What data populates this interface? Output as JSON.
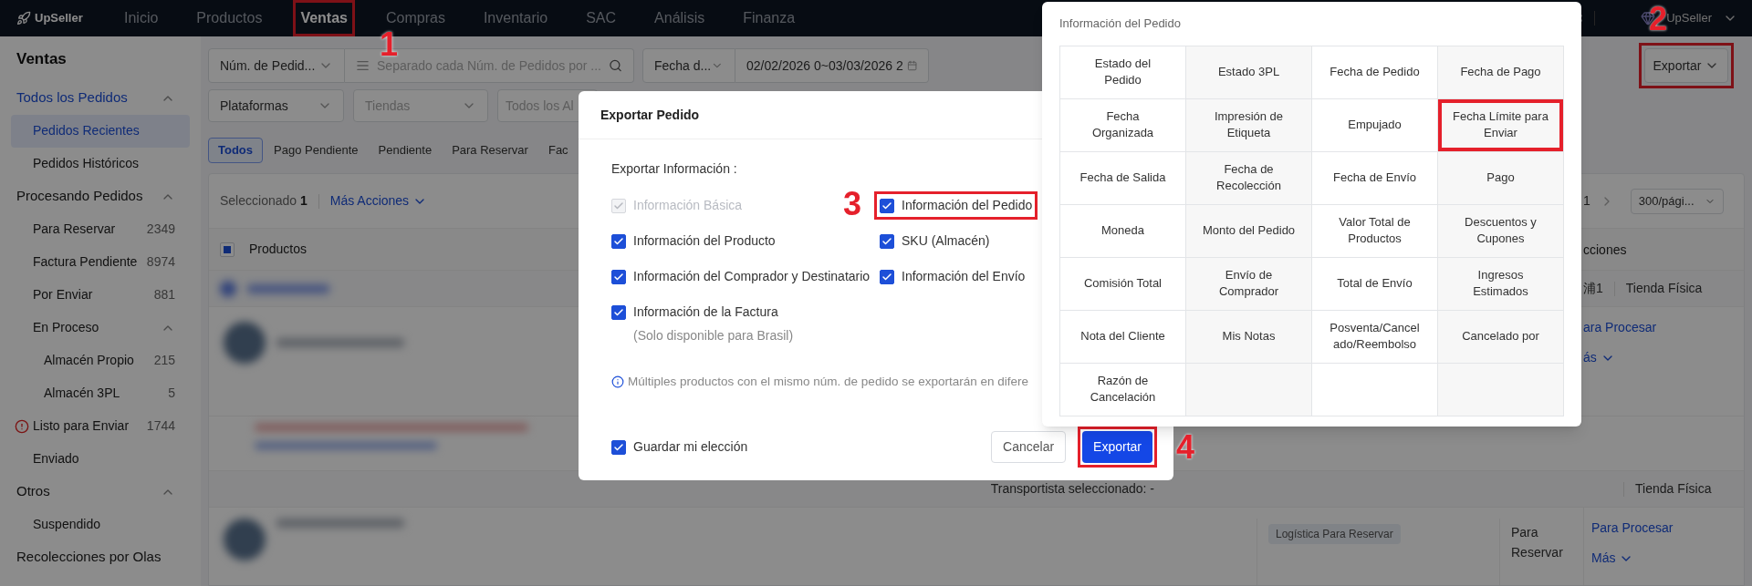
{
  "topbar": {
    "logo": "UpSeller",
    "nav": [
      {
        "label": "Inicio",
        "selected": false,
        "highlighted": false
      },
      {
        "label": "Productos",
        "selected": false,
        "highlighted": false
      },
      {
        "label": "Ventas",
        "selected": true,
        "highlighted": true
      },
      {
        "label": "Compras",
        "selected": false,
        "highlighted": false
      },
      {
        "label": "Inventario",
        "selected": false,
        "highlighted": false
      },
      {
        "label": "SAC",
        "selected": false,
        "highlighted": false
      },
      {
        "label": "Análisis",
        "selected": false,
        "highlighted": false
      },
      {
        "label": "Finanza",
        "selected": false,
        "highlighted": false
      }
    ],
    "user": "UpSeller"
  },
  "sidebar": {
    "title": "Ventas",
    "items": [
      {
        "label": "Todos los Pedidos",
        "active": true,
        "expanded": true,
        "children": [
          {
            "label": "Pedidos Recientes",
            "selected": true
          },
          {
            "label": "Pedidos Históricos",
            "selected": false
          }
        ]
      },
      {
        "label": "Procesando Pedidos",
        "active": false,
        "expanded": true,
        "children": [
          {
            "label": "Para Reservar",
            "count": "2349",
            "selected": false
          },
          {
            "label": "Factura Pendiente",
            "count": "8974",
            "selected": false
          },
          {
            "label": "Por Enviar",
            "count": "881",
            "selected": false
          },
          {
            "label": "En Proceso",
            "expanded": true,
            "selected": false,
            "children": [
              {
                "label": "Almacén Propio",
                "count": "215",
                "selected": false
              },
              {
                "label": "Almacén 3PL",
                "count": "5",
                "selected": false
              }
            ]
          },
          {
            "label": "Listo para Enviar",
            "count": "1744",
            "alert": true,
            "selected": false
          },
          {
            "label": "Enviado",
            "selected": false
          }
        ]
      },
      {
        "label": "Otros",
        "active": false,
        "expanded": true,
        "children": [
          {
            "label": "Suspendido",
            "selected": false
          }
        ]
      },
      {
        "label": "Recolecciones por Olas",
        "active": false
      }
    ]
  },
  "filters": {
    "search_type": "Núm. de Pedid...",
    "search_placeholder": "Separado cada Núm. de Pedidos por ...",
    "date_type": "Fecha d...",
    "date_range": "02/02/2026 0~03/03/2026 2",
    "platform": "Plataformas",
    "store_placeholder": "Tiendas",
    "warehouse_placeholder": "Todos los Al"
  },
  "export_button": {
    "label": "Exportar",
    "highlighted": true
  },
  "tabs": [
    {
      "label": "Todos",
      "selected": true
    },
    {
      "label": "Pago Pendiente",
      "selected": false
    },
    {
      "label": "Pendiente",
      "selected": false
    },
    {
      "label": "Para Reservar",
      "selected": false
    },
    {
      "label": "Fac",
      "selected": false
    }
  ],
  "toolbar": {
    "selected_label": "Seleccionado",
    "selected_count": "1",
    "more_actions": "Más Acciones",
    "page": "1",
    "page_size": "300/pági..."
  },
  "table": {
    "header_checkbox": {
      "indeterminate": true
    },
    "columns": [
      "Productos",
      "cciones"
    ],
    "group_1": {
      "shop": "浦1",
      "store_type": "Tienda Física"
    },
    "row_1": {
      "action": "ara Procesar",
      "more": "ás"
    },
    "group_2": {
      "carrier": "Transportista seleccionado: -",
      "store_type": "Tienda Física"
    },
    "row_2": {
      "tag": "Logística Para Reservar",
      "status": "Para Reservar",
      "action": "Para Procesar",
      "more": "Más"
    }
  },
  "modal": {
    "title": "Exportar Pedido",
    "section_label": "Exportar Información :",
    "options": [
      {
        "label": "Información Básica",
        "checked": true,
        "disabled": true,
        "highlighted": false
      },
      {
        "label": "Información del Pedido",
        "checked": true,
        "disabled": false,
        "highlighted": true
      },
      {
        "label": "Información del Producto",
        "checked": true,
        "disabled": false,
        "highlighted": false
      },
      {
        "label": "SKU (Almacén)",
        "checked": true,
        "disabled": false,
        "highlighted": false
      },
      {
        "label": "Información del Comprador y Destinatario",
        "checked": true,
        "disabled": false,
        "highlighted": false
      },
      {
        "label": "Información del Envío",
        "checked": true,
        "disabled": false,
        "highlighted": false
      },
      {
        "label": "Información de la Factura",
        "note": "(Solo disponible para Brasil)",
        "checked": true,
        "disabled": false,
        "highlighted": false
      }
    ],
    "notice": "Múltiples productos con el mismo núm. de pedido se exportarán en difere",
    "remember": {
      "label": "Guardar mi elección",
      "checked": true
    },
    "buttons": [
      {
        "label": "Cancelar",
        "kind": "secondary",
        "highlighted": false
      },
      {
        "label": "Exportar",
        "kind": "primary",
        "highlighted": true
      }
    ]
  },
  "popover": {
    "title": "Información del Pedido",
    "fields": [
      {
        "label": "Estado del Pedido",
        "highlighted": false
      },
      {
        "label": "Estado 3PL",
        "highlighted": false
      },
      {
        "label": "Fecha de Pedido",
        "highlighted": false
      },
      {
        "label": "Fecha de Pago",
        "highlighted": false
      },
      {
        "label": "Fecha Organizada",
        "highlighted": false
      },
      {
        "label": "Impresión de Etiqueta",
        "highlighted": false
      },
      {
        "label": "Empujado",
        "highlighted": false
      },
      {
        "label": "Fecha Límite para Enviar",
        "highlighted": true
      },
      {
        "label": "Fecha de Salida",
        "highlighted": false
      },
      {
        "label": "Fecha de Recolección",
        "highlighted": false
      },
      {
        "label": "Fecha de Envío",
        "highlighted": false
      },
      {
        "label": "Pago",
        "highlighted": false
      },
      {
        "label": "Moneda",
        "highlighted": false
      },
      {
        "label": "Monto del Pedido",
        "highlighted": false
      },
      {
        "label": "Valor Total de Productos",
        "highlighted": false
      },
      {
        "label": "Descuentos y Cupones",
        "highlighted": false
      },
      {
        "label": "Comisión Total",
        "highlighted": false
      },
      {
        "label": "Envío de Comprador",
        "highlighted": false
      },
      {
        "label": "Total de Envío",
        "highlighted": false
      },
      {
        "label": "Ingresos Estimados",
        "highlighted": false
      },
      {
        "label": "Nota del Cliente",
        "highlighted": false
      },
      {
        "label": "Mis Notas",
        "highlighted": false
      },
      {
        "label": "Posventa/Cancelado/Reembolso",
        "highlighted": false
      },
      {
        "label": "Cancelado por",
        "highlighted": false
      },
      {
        "label": "Razón de Cancelación",
        "highlighted": false
      }
    ]
  },
  "callouts": [
    "1",
    "2",
    "3",
    "4"
  ]
}
